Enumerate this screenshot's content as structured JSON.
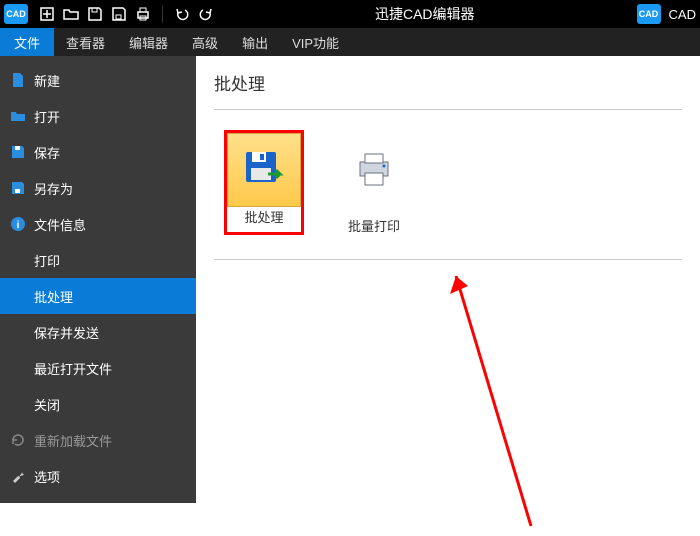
{
  "title": "迅捷CAD编辑器",
  "title_right": "CAD",
  "tab_file": "文件",
  "menus": [
    "查看器",
    "编辑器",
    "高级",
    "输出",
    "VIP功能"
  ],
  "sidebar": [
    {
      "label": "新建",
      "icon": "new"
    },
    {
      "label": "打开",
      "icon": "open"
    },
    {
      "label": "保存",
      "icon": "save"
    },
    {
      "label": "另存为",
      "icon": "saveas"
    },
    {
      "label": "文件信息",
      "icon": "info"
    },
    {
      "label": "打印",
      "icon": ""
    },
    {
      "label": "批处理",
      "icon": "",
      "selected": true
    },
    {
      "label": "保存并发送",
      "icon": ""
    },
    {
      "label": "最近打开文件",
      "icon": ""
    },
    {
      "label": "关闭",
      "icon": ""
    },
    {
      "label": "重新加载文件",
      "icon": "reload",
      "disabled": true
    },
    {
      "label": "选项",
      "icon": "options"
    }
  ],
  "panel": {
    "title": "批处理",
    "tools": [
      {
        "label": "批处理",
        "selected": true,
        "icon": "batch-save"
      },
      {
        "label": "批量打印",
        "icon": "batch-print"
      }
    ]
  }
}
